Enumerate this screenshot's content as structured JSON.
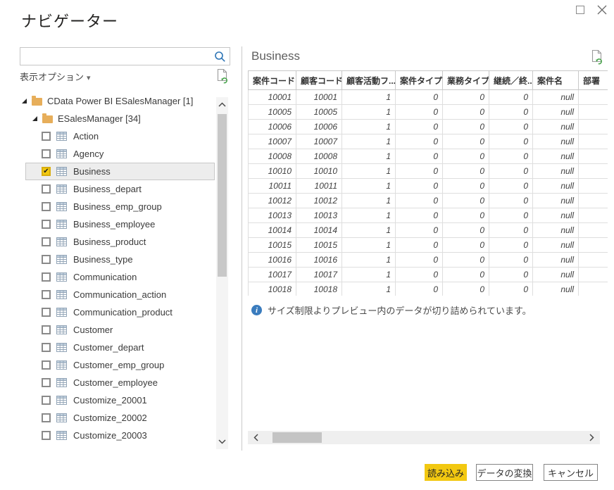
{
  "window": {
    "title": "ナビゲーター"
  },
  "left_panel": {
    "search_value": "",
    "display_options_label": "表示オプション",
    "tree": {
      "folders": [
        {
          "label": "CData Power BI ESalesManager [1]",
          "level": 0
        },
        {
          "label": "ESalesManager [34]",
          "level": 1
        }
      ],
      "tables": [
        {
          "label": "Action",
          "checked": false,
          "selected": false
        },
        {
          "label": "Agency",
          "checked": false,
          "selected": false
        },
        {
          "label": "Business",
          "checked": true,
          "selected": true
        },
        {
          "label": "Business_depart",
          "checked": false,
          "selected": false
        },
        {
          "label": "Business_emp_group",
          "checked": false,
          "selected": false
        },
        {
          "label": "Business_employee",
          "checked": false,
          "selected": false
        },
        {
          "label": "Business_product",
          "checked": false,
          "selected": false
        },
        {
          "label": "Business_type",
          "checked": false,
          "selected": false
        },
        {
          "label": "Communication",
          "checked": false,
          "selected": false
        },
        {
          "label": "Communication_action",
          "checked": false,
          "selected": false
        },
        {
          "label": "Communication_product",
          "checked": false,
          "selected": false
        },
        {
          "label": "Customer",
          "checked": false,
          "selected": false
        },
        {
          "label": "Customer_depart",
          "checked": false,
          "selected": false
        },
        {
          "label": "Customer_emp_group",
          "checked": false,
          "selected": false
        },
        {
          "label": "Customer_employee",
          "checked": false,
          "selected": false
        },
        {
          "label": "Customize_20001",
          "checked": false,
          "selected": false
        },
        {
          "label": "Customize_20002",
          "checked": false,
          "selected": false
        },
        {
          "label": "Customize_20003",
          "checked": false,
          "selected": false
        }
      ]
    }
  },
  "preview": {
    "title": "Business",
    "table": {
      "columns": [
        "案件コード",
        "顧客コード",
        "顧客活動フ...",
        "案件タイプ",
        "業務タイプ",
        "継続／終...",
        "案件名",
        "部署"
      ],
      "rows": [
        [
          "10001",
          "10001",
          "1",
          "0",
          "0",
          "0",
          "null",
          ""
        ],
        [
          "10005",
          "10005",
          "1",
          "0",
          "0",
          "0",
          "null",
          ""
        ],
        [
          "10006",
          "10006",
          "1",
          "0",
          "0",
          "0",
          "null",
          ""
        ],
        [
          "10007",
          "10007",
          "1",
          "0",
          "0",
          "0",
          "null",
          ""
        ],
        [
          "10008",
          "10008",
          "1",
          "0",
          "0",
          "0",
          "null",
          ""
        ],
        [
          "10010",
          "10010",
          "1",
          "0",
          "0",
          "0",
          "null",
          ""
        ],
        [
          "10011",
          "10011",
          "1",
          "0",
          "0",
          "0",
          "null",
          ""
        ],
        [
          "10012",
          "10012",
          "1",
          "0",
          "0",
          "0",
          "null",
          ""
        ],
        [
          "10013",
          "10013",
          "1",
          "0",
          "0",
          "0",
          "null",
          ""
        ],
        [
          "10014",
          "10014",
          "1",
          "0",
          "0",
          "0",
          "null",
          ""
        ],
        [
          "10015",
          "10015",
          "1",
          "0",
          "0",
          "0",
          "null",
          ""
        ],
        [
          "10016",
          "10016",
          "1",
          "0",
          "0",
          "0",
          "null",
          ""
        ],
        [
          "10017",
          "10017",
          "1",
          "0",
          "0",
          "0",
          "null",
          ""
        ],
        [
          "10018",
          "10018",
          "1",
          "0",
          "0",
          "0",
          "null",
          ""
        ]
      ]
    },
    "info_message": "サイズ制限よりプレビュー内のデータが切り詰められています。"
  },
  "footer": {
    "load_label": "読み込み",
    "transform_label": "データの変換",
    "cancel_label": "キャンセル"
  },
  "icons": {
    "check_glyph": "✔",
    "caret_glyph": "▾",
    "info_glyph": "i"
  },
  "colors": {
    "accent_yellow": "#f2c811",
    "info_blue": "#3a7cbe",
    "search_blue": "#2e75b6",
    "folder_tan": "#e7ae5a",
    "refresh_green": "#44a348"
  }
}
